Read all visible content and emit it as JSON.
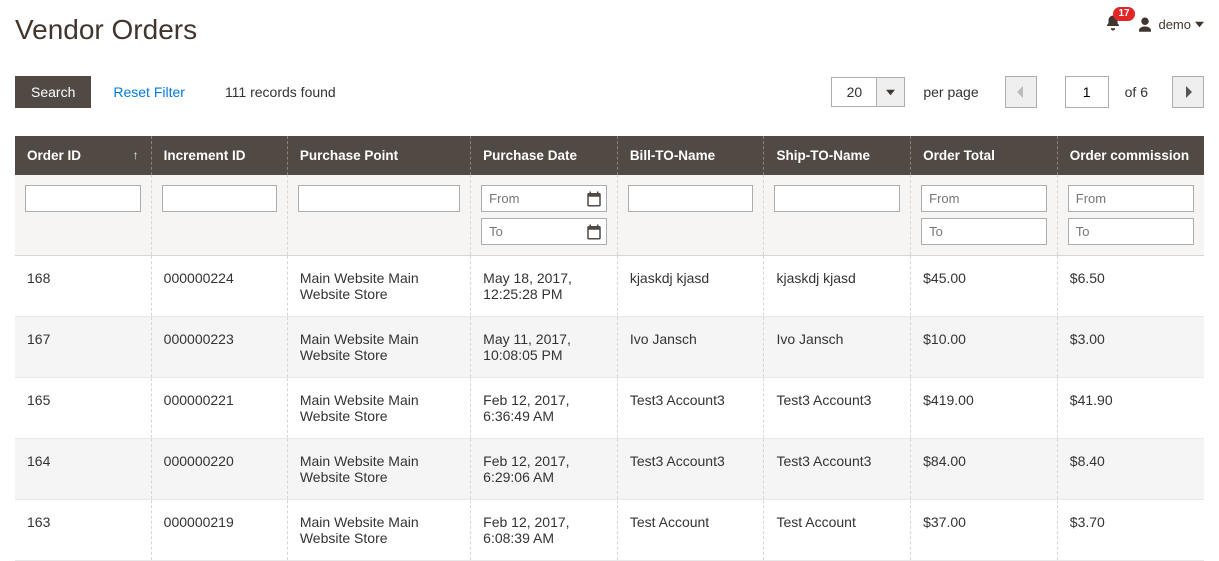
{
  "header": {
    "title": "Vendor Orders",
    "notifications_count": "17",
    "user_name": "demo"
  },
  "toolbar": {
    "search_label": "Search",
    "reset_filter_label": "Reset Filter",
    "records_found": "111 records found",
    "per_page_value": "20",
    "per_page_label": "per page",
    "current_page": "1",
    "of_pages": "of 6"
  },
  "columns": {
    "order_id": "Order ID",
    "increment_id": "Increment ID",
    "purchase_point": "Purchase Point",
    "purchase_date": "Purchase Date",
    "bill_to_name": "Bill-TO-Name",
    "ship_to_name": "Ship-TO-Name",
    "order_total": "Order Total",
    "order_commission": "Order commission"
  },
  "filters": {
    "from_placeholder": "From",
    "to_placeholder": "To"
  },
  "rows": [
    {
      "order_id": "168",
      "increment_id": "000000224",
      "purchase_point": "Main Website Main Website Store",
      "purchase_date": "May 18, 2017, 12:25:28 PM",
      "bill_to": "kjaskdj kjasd",
      "ship_to": "kjaskdj kjasd",
      "order_total": "$45.00",
      "commission": "$6.50"
    },
    {
      "order_id": "167",
      "increment_id": "000000223",
      "purchase_point": "Main Website Main Website Store",
      "purchase_date": "May 11, 2017, 10:08:05 PM",
      "bill_to": "Ivo Jansch",
      "ship_to": "Ivo Jansch",
      "order_total": "$10.00",
      "commission": "$3.00"
    },
    {
      "order_id": "165",
      "increment_id": "000000221",
      "purchase_point": "Main Website Main Website Store",
      "purchase_date": "Feb 12, 2017, 6:36:49 AM",
      "bill_to": "Test3 Account3",
      "ship_to": "Test3 Account3",
      "order_total": "$419.00",
      "commission": "$41.90"
    },
    {
      "order_id": "164",
      "increment_id": "000000220",
      "purchase_point": "Main Website Main Website Store",
      "purchase_date": "Feb 12, 2017, 6:29:06 AM",
      "bill_to": "Test3 Account3",
      "ship_to": "Test3 Account3",
      "order_total": "$84.00",
      "commission": "$8.40"
    },
    {
      "order_id": "163",
      "increment_id": "000000219",
      "purchase_point": "Main Website Main Website Store",
      "purchase_date": "Feb 12, 2017, 6:08:39 AM",
      "bill_to": "Test Account",
      "ship_to": "Test Account",
      "order_total": "$37.00",
      "commission": "$3.70"
    }
  ]
}
